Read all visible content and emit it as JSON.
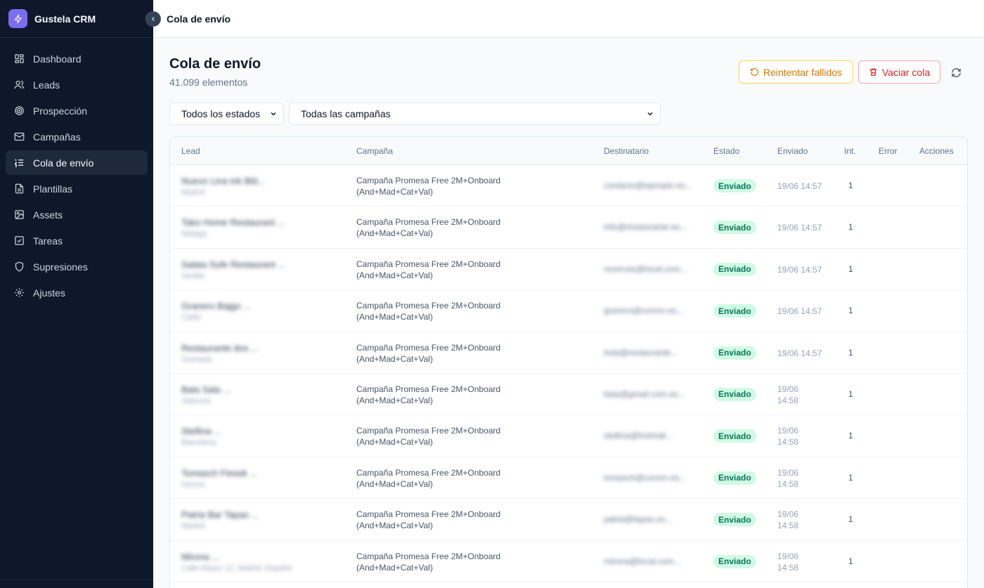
{
  "app": {
    "name": "Gustela CRM",
    "accent": "#7c6cf0",
    "sidebar_bg": "#0f172a"
  },
  "sidebar": {
    "items": [
      {
        "label": "Dashboard",
        "icon": "dashboard-icon",
        "active": false
      },
      {
        "label": "Leads",
        "icon": "users-icon",
        "active": false
      },
      {
        "label": "Prospección",
        "icon": "target-icon",
        "active": false
      },
      {
        "label": "Campañas",
        "icon": "mail-icon",
        "active": false
      },
      {
        "label": "Cola de envío",
        "icon": "list-ordered-icon",
        "active": true
      },
      {
        "label": "Plantillas",
        "icon": "file-text-icon",
        "active": false
      },
      {
        "label": "Assets",
        "icon": "image-icon",
        "active": false
      },
      {
        "label": "Tareas",
        "icon": "checkbox-icon",
        "active": false
      },
      {
        "label": "Supresiones",
        "icon": "shield-icon",
        "active": false
      },
      {
        "label": "Ajustes",
        "icon": "gear-icon",
        "active": false
      }
    ]
  },
  "topbar": {
    "title": "Cola de envío"
  },
  "header": {
    "title": "Cola de envío",
    "subtitle": "41.099 elementos",
    "retry_label": "Reintentar fallidos",
    "clear_label": "Vaciar cola"
  },
  "filters": {
    "status": "Todos los estados",
    "campaign": "Todas las campañas"
  },
  "table": {
    "columns": [
      "Lead",
      "Campaña",
      "Destinatario",
      "Estado",
      "Enviado",
      "Int.",
      "Error",
      "Acciones"
    ],
    "rows": [
      {
        "lead": "Nuevo Lina ink Bld...",
        "lead_sub": "Madrid",
        "campaign": "Campaña Promesa Free 2M+Onboard (And+Mad+Cat+Val)",
        "recipient": "contacto@ejemplo.es...",
        "status": "Enviado",
        "sent": "19/06 14:57",
        "tries": "1",
        "error": "",
        "two": false
      },
      {
        "lead": "Tako Home Restaurant ...",
        "lead_sub": "Málaga",
        "campaign": "Campaña Promesa Free 2M+Onboard (And+Mad+Cat+Val)",
        "recipient": "info@restaurante.es...",
        "status": "Enviado",
        "sent": "19/06 14:57",
        "tries": "1",
        "error": "",
        "two": false
      },
      {
        "lead": "Salaia Sufe Restaurant ...",
        "lead_sub": "Sevilla",
        "campaign": "Campaña Promesa Free 2M+Onboard (And+Mad+Cat+Val)",
        "recipient": "reservas@local.com...",
        "status": "Enviado",
        "sent": "19/06 14:57",
        "tries": "1",
        "error": "",
        "two": false
      },
      {
        "lead": "Granero Bajgo ...",
        "lead_sub": "Cádiz",
        "campaign": "Campaña Promesa Free 2M+Onboard (And+Mad+Cat+Val)",
        "recipient": "granero@correo.es...",
        "status": "Enviado",
        "sent": "19/06 14:57",
        "tries": "1",
        "error": "",
        "two": false
      },
      {
        "lead": "Restaurante dos ...",
        "lead_sub": "Granada",
        "campaign": "Campaña Promesa Free 2M+Onboard (And+Mad+Cat+Val)",
        "recipient": "hola@restaurante...",
        "status": "Enviado",
        "sent": "19/06 14:57",
        "tries": "1",
        "error": "",
        "two": false
      },
      {
        "lead": "Bala Sala ...",
        "lead_sub": "Valencia",
        "campaign": "Campaña Promesa Free 2M+Onboard (And+Mad+Cat+Val)",
        "recipient": "bala@gmail.com.es...",
        "status": "Enviado",
        "sent": "19/06 14:58",
        "tries": "1",
        "error": "",
        "two": true
      },
      {
        "lead": "Stellina ...",
        "lead_sub": "Barcelona",
        "campaign": "Campaña Promesa Free 2M+Onboard (And+Mad+Cat+Val)",
        "recipient": "stellina@hotmail...",
        "status": "Enviado",
        "sent": "19/06 14:58",
        "tries": "1",
        "error": "",
        "two": true
      },
      {
        "lead": "Tomasch Fiesek ...",
        "lead_sub": "Girona",
        "campaign": "Campaña Promesa Free 2M+Onboard (And+Mad+Cat+Val)",
        "recipient": "tomasch@correo.es...",
        "status": "Enviado",
        "sent": "19/06 14:58",
        "tries": "1",
        "error": "",
        "two": true
      },
      {
        "lead": "Patria Bar Tapas ...",
        "lead_sub": "Madrid",
        "campaign": "Campaña Promesa Free 2M+Onboard (And+Mad+Cat+Val)",
        "recipient": "patria@tapas.es...",
        "status": "Enviado",
        "sent": "19/06 14:58",
        "tries": "1",
        "error": "",
        "two": true
      },
      {
        "lead": "Mirona ...",
        "lead_sub": "Calle Mayor 12, Madrid, España",
        "campaign": "Campaña Promesa Free 2M+Onboard (And+Mad+Cat+Val)",
        "recipient": "mirona@local.com...",
        "status": "Enviado",
        "sent": "19/06 14:58",
        "tries": "1",
        "error": "",
        "two": true
      }
    ]
  }
}
